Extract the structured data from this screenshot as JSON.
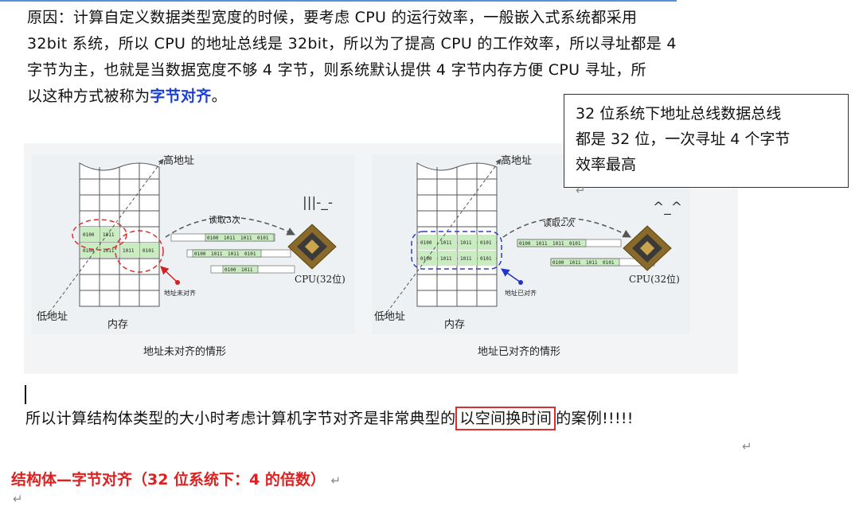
{
  "paragraph": {
    "line1": "原因：计算自定义数据类型宽度的时候，要考虑 CPU 的运行效率，一般嵌入式系统都采用",
    "line2": "32bit 系统，所以 CPU 的地址总线是 32bit，所以为了提高 CPU 的工作效率，所以寻址都是 4",
    "line3": "字节为主，也就是当数据宽度不够 4 字节，则系统默认提供 4 字节内存方便 CPU 寻址，所",
    "line4_prefix": "以这种方式被称为",
    "line4_highlight": "字节对齐",
    "line4_suffix": "。"
  },
  "callout": {
    "line1": "32 位系统下地址总线数据总线",
    "line2": "都是 32 位，一次寻址 4 个字节",
    "line3": "效率最高",
    "mark": "↵"
  },
  "diagram": {
    "left": {
      "high_addr": "高地址",
      "low_addr": "低地址",
      "memory": "内存",
      "read_count": "读取3次",
      "pointer_label": "地址未对齐",
      "cpu": "CPU(32位)",
      "face": "|||-_-",
      "caption": "地址未对齐的情形",
      "cells": [
        "0100",
        "1011",
        "0100",
        "1011",
        "1011",
        "0101"
      ],
      "bus_rows": [
        [
          "0100",
          "1011",
          "1011",
          "0101"
        ],
        [
          "0100",
          "1011",
          "1011",
          "0101"
        ],
        [
          "0100",
          "1011"
        ]
      ]
    },
    "right": {
      "high_addr": "高地址",
      "low_addr": "低地址",
      "memory": "内存",
      "read_count": "读取2次",
      "pointer_label": "地址已对齐",
      "cpu": "CPU(32位)",
      "face": "^_^",
      "caption": "地址已对齐的情形",
      "cells": [
        "0100",
        "1011",
        "1011",
        "0101",
        "0100",
        "1011",
        "1011",
        "0101"
      ],
      "bus_rows": [
        [
          "0100",
          "1011",
          "1011",
          "0101"
        ],
        [
          "0100",
          "1011",
          "1011",
          "0101"
        ]
      ]
    }
  },
  "summary": {
    "prefix": "所以计算结构体类型的大小时考虑计算机字节对齐是非常典型的",
    "boxed": "以空间换时间",
    "suffix": "的案例!!!!!"
  },
  "heading": {
    "text": "结构体—字节对齐（32 位系统下：4 的倍数）",
    "mark": "↵"
  },
  "para_mark": "↵",
  "colors": {
    "highlight_blue": "#1a3ed6",
    "heading_red": "#e02020",
    "box_red": "#d83030",
    "cell_green": "#c9ecc0"
  }
}
